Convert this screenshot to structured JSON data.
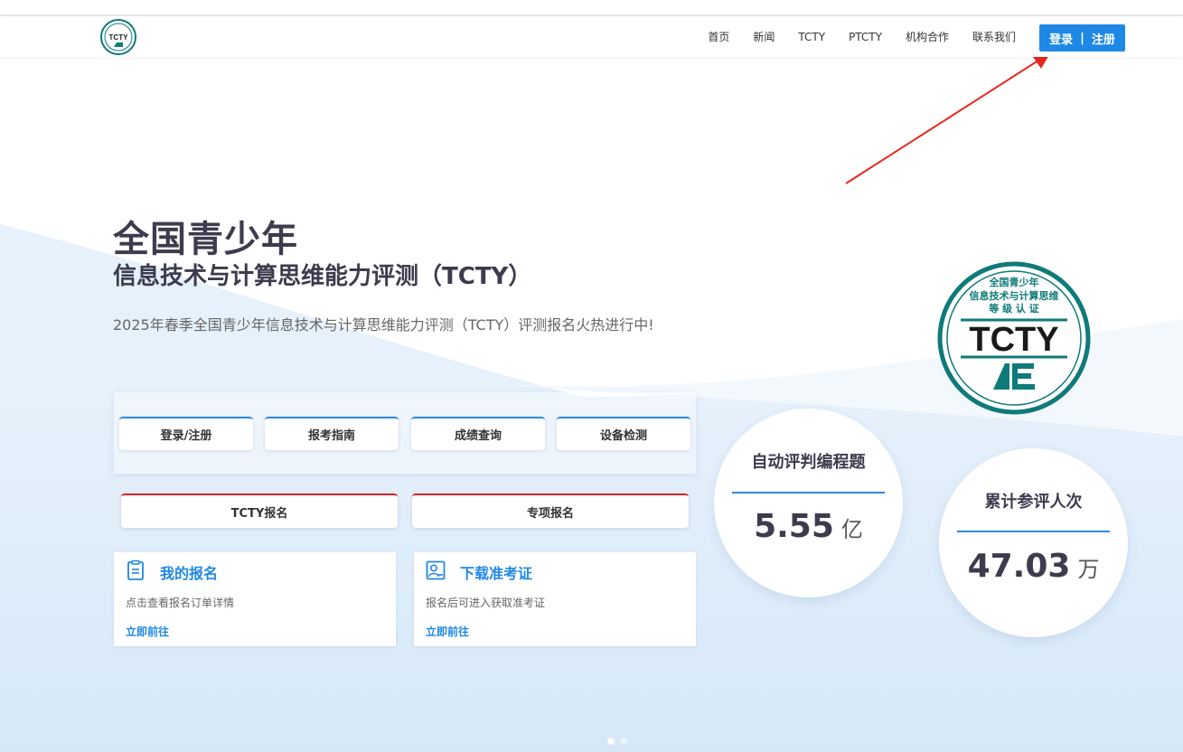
{
  "header": {
    "logo_text": "TCTY",
    "nav": [
      "首页",
      "新闻",
      "TCTY",
      "PTCTY",
      "机构合作",
      "联系我们"
    ],
    "login_label": "登录",
    "register_label": "注册",
    "separator": "|"
  },
  "hero": {
    "title_main": "全国青少年",
    "title_sub": "信息技术与计算思维能力评测（TCTY）",
    "description": "2025年春季全国青少年信息技术与计算思维能力评测（TCTY）评测报名火热进行中!"
  },
  "quick_buttons": [
    "登录/注册",
    "报考指南",
    "成绩查询",
    "设备检测"
  ],
  "register_buttons": [
    "TCTY报名",
    "专项报名"
  ],
  "cards": [
    {
      "title": "我的报名",
      "text": "点击查看报名订单详情",
      "link": "立即前往",
      "icon": "clipboard-icon"
    },
    {
      "title": "下载准考证",
      "text": "报名后可进入获取准考证",
      "link": "立即前往",
      "icon": "id-card-icon"
    }
  ],
  "stats": [
    {
      "label": "自动评判编程题",
      "value": "5.55",
      "unit": "亿"
    },
    {
      "label": "累计参评人次",
      "value": "47.03",
      "unit": "万"
    }
  ],
  "badge": {
    "line1": "全国青少年",
    "line2": "信息技术与计算思维",
    "line3": "等 级 认 证",
    "big": "TCTY"
  },
  "colors": {
    "primary": "#1e88e5",
    "accent_red": "#d6262b",
    "badge_teal": "#0f7a7a",
    "text_dark": "#3c3c4e"
  }
}
